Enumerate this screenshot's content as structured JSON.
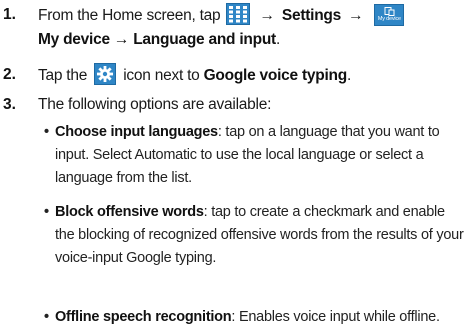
{
  "steps": [
    {
      "num": "1.",
      "prefix": "From the Home screen, tap",
      "arrow1": "→",
      "settings": "Settings",
      "arrow2": "→",
      "line2_bold": "My device → Language and input",
      "line2_end": "."
    },
    {
      "num": "2.",
      "prefix": "Tap the",
      "mid": "icon next to",
      "bold": "Google voice typing",
      "end": "."
    },
    {
      "num": "3.",
      "text": "The following options are available:"
    }
  ],
  "icons": {
    "apps": "apps-grid-icon",
    "my_device": "my-device-icon",
    "my_device_label": "My device",
    "gear": "gear-icon"
  },
  "options": [
    {
      "title": "Choose input languages",
      "desc": ": tap on a language that you want to input. Select Automatic to use the local language or select a language from the list."
    },
    {
      "title": "Block offensive words",
      "desc": ": tap to create a checkmark and enable the blocking of recognized offensive words from the results of your voice-input Google typing."
    },
    {
      "title": "Offline speech recognition",
      "desc": ": Enables voice input while offline."
    }
  ],
  "colors": {
    "icon_blue": "#2f86c6",
    "text": "#1a1a1a"
  }
}
